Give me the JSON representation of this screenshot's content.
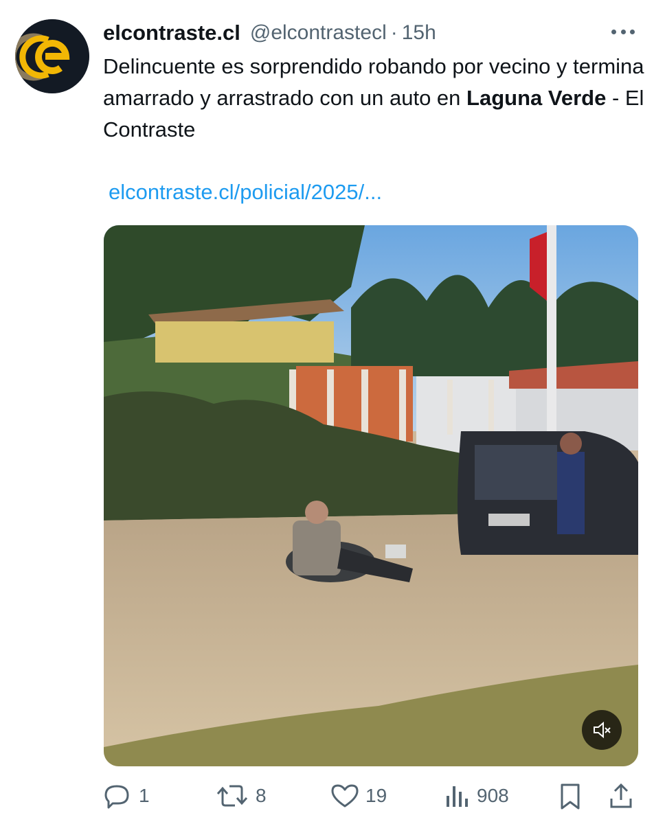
{
  "account": {
    "display_name": "elcontraste.cl",
    "handle": "@elcontrastecl",
    "separator": "·",
    "time": "15h",
    "avatar_icon": "elcontraste-logo-icon"
  },
  "tweet": {
    "text_normal": "Delincuente es sorprendido robando por vecino y termina amarrado y arrastrado con un auto en ",
    "text_bold": "Laguna Verde",
    "text_tail": " - El Contraste",
    "link": "elcontraste.cl/policial/2025/..."
  },
  "media": {
    "type": "video",
    "mute_icon": "speaker-muted-icon"
  },
  "actions": {
    "replies": "1",
    "reposts": "8",
    "likes": "19",
    "views": "908",
    "reply_icon": "reply-icon",
    "repost_icon": "repost-icon",
    "like_icon": "heart-icon",
    "views_icon": "views-bar-chart-icon",
    "bookmark_icon": "bookmark-icon",
    "share_icon": "share-icon"
  },
  "colors": {
    "link": "#1d9bf0",
    "secondary_text": "#536471",
    "logo_accent": "#f2b705",
    "avatar_bg": "#131a24"
  }
}
